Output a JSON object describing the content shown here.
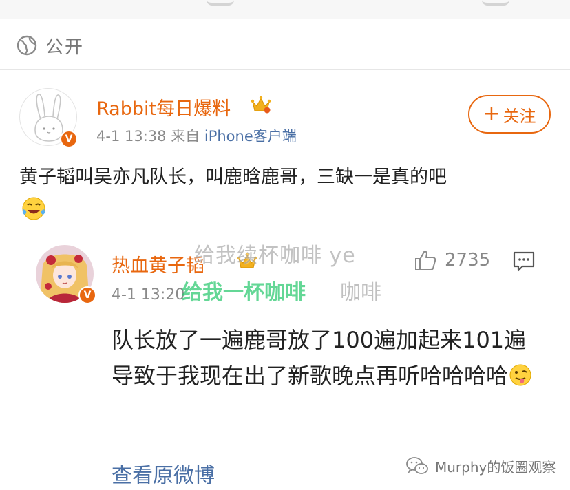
{
  "visibility": {
    "label": "公开",
    "icon": "globe-icon"
  },
  "post": {
    "author": "Rabbit每日爆料",
    "time": "4-1 13:38",
    "source_prefix": "来自",
    "source": "iPhone客户端",
    "follow_label": "关注",
    "text": "黄子韬叫吴亦凡队长，叫鹿晗鹿哥，三缺一是真的吧",
    "verified_badge": "V"
  },
  "reply": {
    "author": "热血黄子韬",
    "time": "4-1 13:20",
    "likes": "2735",
    "text": "队长放了一遍鹿哥放了100遍加起来101遍导致于我现在出了新歌晚点再听哈哈哈哈",
    "verified_badge": "V"
  },
  "watermarks": {
    "line1": "给我续杯咖啡 ye",
    "line2": "给我一杯咖啡",
    "line3": "咖啡"
  },
  "view_original": "查看原微博",
  "credit": "Murphy的饭圈观察",
  "colors": {
    "accent": "#e8670f",
    "link": "#4a6fa5",
    "watermark_green": "#28c86e"
  }
}
